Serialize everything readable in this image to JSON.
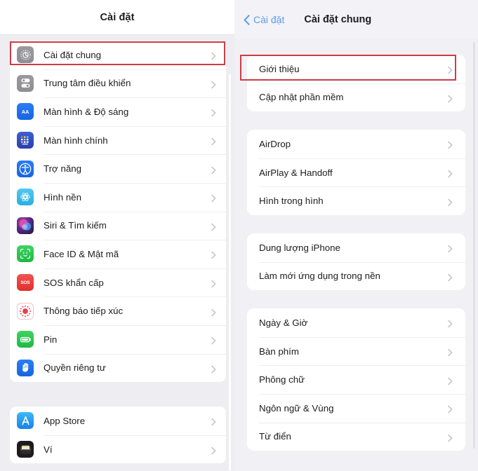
{
  "colors": {
    "highlight": "#cf3b43",
    "accent_blue": "#5d9cec",
    "chevron": "#c7c7cc",
    "panel_bg": "#ededf2",
    "card": "#ffffff",
    "text": "#1c1c1e"
  },
  "left_panel": {
    "header": {
      "title": "Cài đặt"
    },
    "groups": [
      {
        "items": [
          {
            "label": "Cài đặt chung",
            "icon": "gear-icon",
            "icon_class": "ic-gear",
            "highlighted": true
          },
          {
            "label": "Trung tâm điều khiển",
            "icon": "sliders-icon",
            "icon_class": "ic-control",
            "highlighted": false
          },
          {
            "label": "Màn hình & Độ sáng",
            "icon": "display-aa-icon",
            "icon_class": "ic-display",
            "highlighted": false,
            "glyph": "AA"
          },
          {
            "label": "Màn hình chính",
            "icon": "home-screen-icon",
            "icon_class": "ic-home",
            "highlighted": false
          },
          {
            "label": "Trợ năng",
            "icon": "accessibility-icon",
            "icon_class": "ic-access",
            "highlighted": false
          },
          {
            "label": "Hình nền",
            "icon": "wallpaper-icon",
            "icon_class": "ic-wallpaper",
            "highlighted": false
          },
          {
            "label": "Siri & Tìm kiếm",
            "icon": "siri-icon",
            "icon_class": "ic-siri",
            "highlighted": false
          },
          {
            "label": "Face ID & Mật mã",
            "icon": "face-id-icon",
            "icon_class": "ic-faceid",
            "highlighted": false
          },
          {
            "label": "SOS khẩn cấp",
            "icon": "sos-icon",
            "icon_class": "ic-sos",
            "highlighted": false,
            "glyph": "SOS"
          },
          {
            "label": "Thông báo tiếp xúc",
            "icon": "exposure-notification-icon",
            "icon_class": "ic-exposure",
            "highlighted": false
          },
          {
            "label": "Pin",
            "icon": "battery-icon",
            "icon_class": "ic-battery",
            "highlighted": false
          },
          {
            "label": "Quyền riêng tư",
            "icon": "privacy-hand-icon",
            "icon_class": "ic-privacy",
            "highlighted": false
          }
        ]
      },
      {
        "items": [
          {
            "label": "App Store",
            "icon": "app-store-icon",
            "icon_class": "ic-appstore",
            "highlighted": false
          },
          {
            "label": "Ví",
            "icon": "wallet-icon",
            "icon_class": "ic-wallet",
            "highlighted": false
          }
        ]
      }
    ]
  },
  "right_panel": {
    "header": {
      "back_label": "Cài đặt",
      "title": "Cài đặt chung"
    },
    "groups": [
      {
        "items": [
          {
            "label": "Giới thiệu",
            "highlighted": true
          },
          {
            "label": "Cập nhật phần mềm",
            "highlighted": false
          }
        ]
      },
      {
        "items": [
          {
            "label": "AirDrop",
            "highlighted": false
          },
          {
            "label": "AirPlay & Handoff",
            "highlighted": false
          },
          {
            "label": "Hình trong hình",
            "highlighted": false
          }
        ]
      },
      {
        "items": [
          {
            "label": "Dung lượng iPhone",
            "highlighted": false
          },
          {
            "label": "Làm mới ứng dụng trong nền",
            "highlighted": false
          }
        ]
      },
      {
        "items": [
          {
            "label": "Ngày & Giờ",
            "highlighted": false
          },
          {
            "label": "Bàn phím",
            "highlighted": false
          },
          {
            "label": "Phông chữ",
            "highlighted": false
          },
          {
            "label": "Ngôn ngữ & Vùng",
            "highlighted": false
          },
          {
            "label": "Từ điển",
            "highlighted": false
          }
        ]
      }
    ]
  }
}
